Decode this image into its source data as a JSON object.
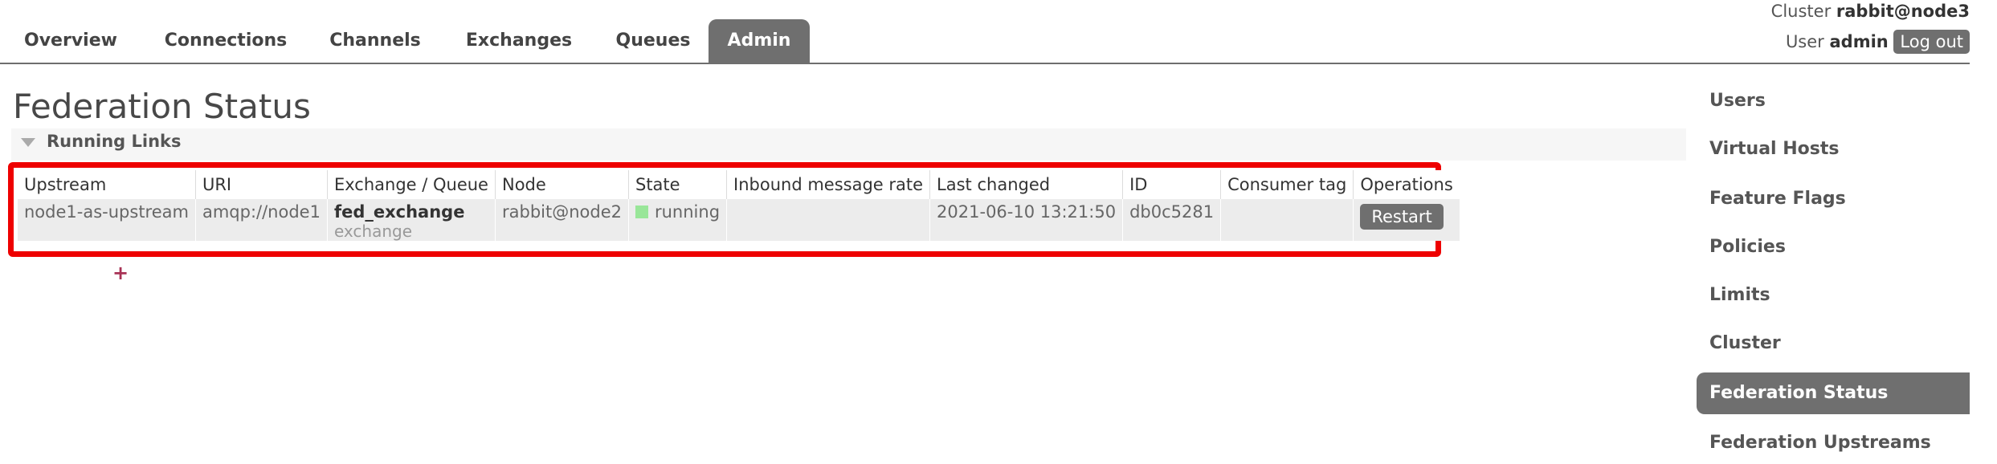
{
  "nav": {
    "tabs": [
      {
        "label": "Overview"
      },
      {
        "label": "Connections"
      },
      {
        "label": "Channels"
      },
      {
        "label": "Exchanges"
      },
      {
        "label": "Queues"
      },
      {
        "label": "Admin",
        "active": true
      }
    ]
  },
  "header": {
    "cluster_label": "Cluster",
    "cluster_name": "rabbit@node3",
    "user_label": "User",
    "user_name": "admin",
    "logout_label": "Log out"
  },
  "page": {
    "title": "Federation Status",
    "section_label": "Running Links",
    "add_symbol": "+"
  },
  "table": {
    "columns": [
      "Upstream",
      "URI",
      "Exchange / Queue",
      "Node",
      "State",
      "Inbound message rate",
      "Last changed",
      "ID",
      "Consumer tag",
      "Operations"
    ],
    "rows": [
      {
        "upstream": "node1-as-upstream",
        "uri": "amqp://node1",
        "exchange_name": "fed_exchange",
        "exchange_type": "exchange",
        "node": "rabbit@node2",
        "state": "running",
        "inbound_rate": "",
        "last_changed": "2021-06-10 13:21:50",
        "id": "db0c5281",
        "consumer_tag": "",
        "operation_label": "Restart"
      }
    ]
  },
  "sidebar": {
    "items": [
      {
        "label": "Users"
      },
      {
        "label": "Virtual Hosts"
      },
      {
        "label": "Feature Flags"
      },
      {
        "label": "Policies"
      },
      {
        "label": "Limits"
      },
      {
        "label": "Cluster"
      },
      {
        "label": "Federation Status",
        "active": true
      },
      {
        "label": "Federation Upstreams"
      }
    ]
  },
  "colors": {
    "highlight_border": "#ee0000",
    "active_tab": "#6f6f6f",
    "running_indicator": "#99e699",
    "add_symbol": "#a83255"
  }
}
